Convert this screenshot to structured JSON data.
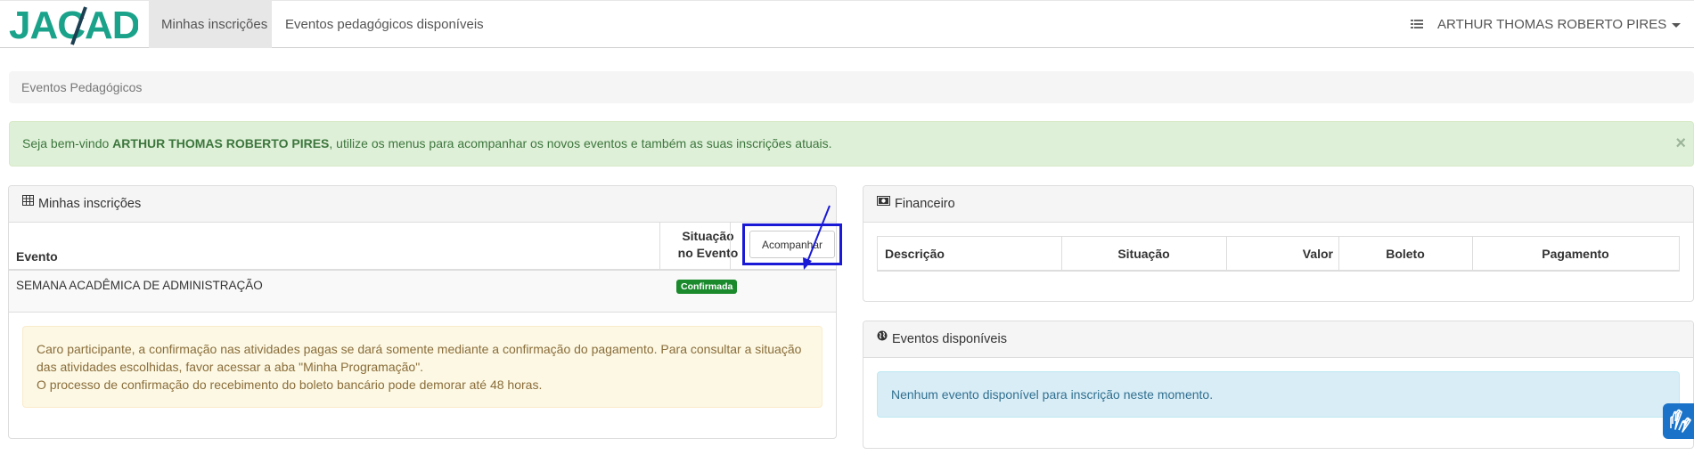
{
  "nav": {
    "brand": "JACAD",
    "tabs": [
      {
        "label": "Minhas inscrições",
        "active": true
      },
      {
        "label": "Eventos pedagógicos disponíveis",
        "active": false
      }
    ],
    "menu_icon": "list-icon",
    "user_name": "ARTHUR THOMAS ROBERTO PIRES"
  },
  "breadcrumb": "Eventos Pedagógicos",
  "welcome": {
    "prefix": "Seja bem-vindo ",
    "name": "ARTHUR THOMAS ROBERTO PIRES",
    "suffix": ", utilize os menus para acompanhar os novos eventos e também as suas inscrições atuais.",
    "close": "×"
  },
  "inscricoes": {
    "title": "Minhas inscrições",
    "icon": "table-icon",
    "headers": {
      "evento": "Evento",
      "situacao_l1": "Situação",
      "situacao_l2": "no Evento"
    },
    "rows": [
      {
        "evento": "SEMANA ACADÊMICA DE ADMINISTRAÇÃO",
        "status": "Confirmada",
        "action": "Acompanhar"
      }
    ],
    "notice": {
      "line1": "Caro participante, a confirmação nas atividades pagas se dará somente mediante a confirmação do pagamento. Para consultar a situação",
      "line2": "das atividades escolhidas, favor acessar a aba \"Minha Programação\".",
      "line3": "O processo de confirmação do recebimento do boleto bancário pode demorar até 48 horas."
    }
  },
  "financeiro": {
    "title": "Financeiro",
    "icon": "money-icon",
    "headers": [
      "Descrição",
      "Situação",
      "Valor",
      "Boleto",
      "Pagamento"
    ]
  },
  "eventos": {
    "title": "Eventos disponíveis",
    "icon": "globe-icon",
    "empty_message": "Nenhum evento disponível para inscrição neste momento."
  },
  "colors": {
    "brand": "#1aa38a",
    "success_bg": "#dff0d8",
    "badge": "#1a8a2c",
    "highlight": "#1a1ad6"
  }
}
